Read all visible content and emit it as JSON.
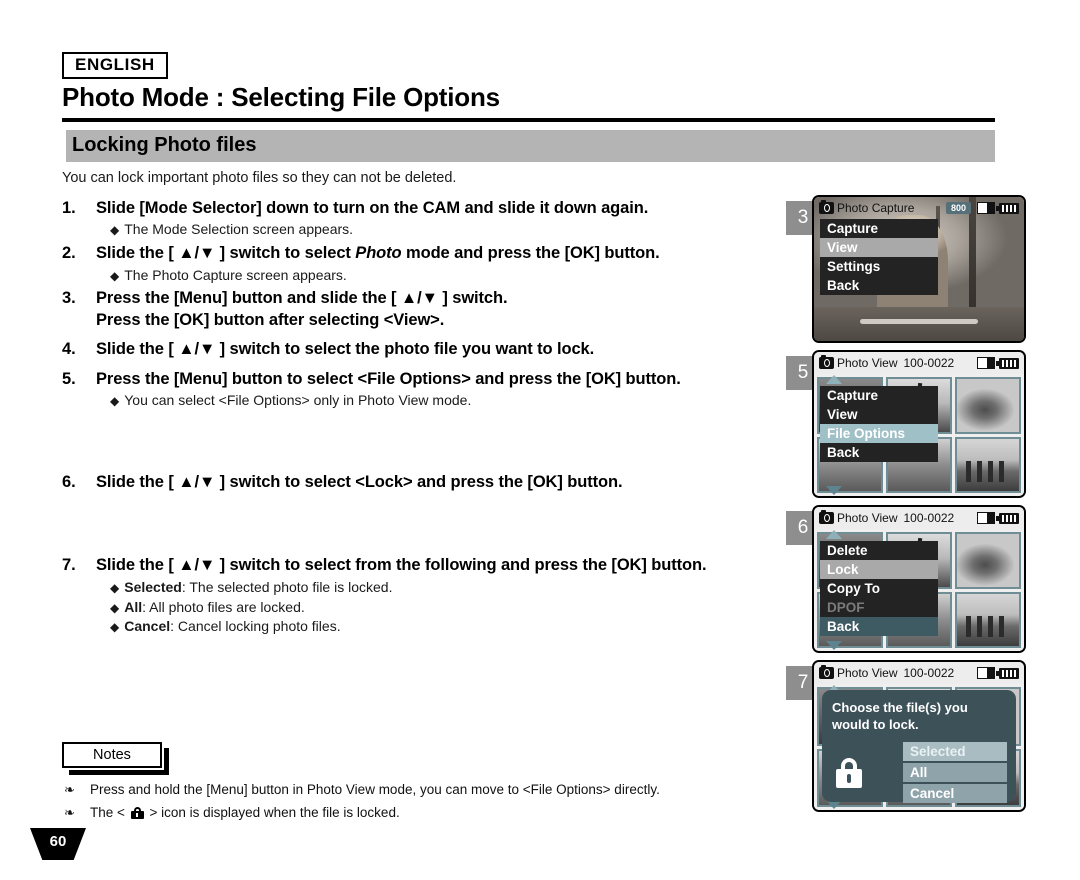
{
  "header": {
    "language": "ENGLISH",
    "title": "Photo Mode : Selecting File Options",
    "section": "Locking Photo files"
  },
  "intro": "You can lock important photo files so they can not be deleted.",
  "steps": [
    {
      "num": "1.",
      "lines": [
        "Slide [Mode Selector] down to turn on the CAM and slide it down again."
      ],
      "subs": [
        "The Mode Selection screen appears."
      ]
    },
    {
      "num": "2.",
      "lines": [
        "Slide the [ ▲/▼ ] switch to select Photo mode and press the [OK] button."
      ],
      "subs": [
        "The Photo Capture screen appears."
      ]
    },
    {
      "num": "3.",
      "lines": [
        "Press the [Menu] button and slide the [ ▲/▼ ] switch.",
        "Press the [OK] button after selecting <View>."
      ],
      "subs": []
    },
    {
      "num": "4.",
      "lines": [
        "Slide the [ ▲/▼ ] switch to select the photo file you want to lock."
      ],
      "subs": []
    },
    {
      "num": "5.",
      "lines": [
        "Press the [Menu] button to select <File Options> and press the [OK] button."
      ],
      "subs": [
        "You can select <File Options> only in Photo View mode."
      ]
    },
    {
      "num": "6.",
      "lines": [
        "Slide the [ ▲/▼ ] switch to select <Lock> and press the [OK] button."
      ],
      "subs": []
    },
    {
      "num": "7.",
      "lines": [
        "Slide the [ ▲/▼ ] switch to select from the following and press the [OK] button."
      ],
      "subs": [
        "Selected: The selected photo file is locked.",
        "All: All photo files are locked.",
        "Cancel: Cancel locking photo files."
      ]
    }
  ],
  "notes": {
    "tab_label": "Notes",
    "items": [
      "Press and hold the [Menu] button in Photo View mode, you can move to <File Options> directly.",
      "The <  > icon is displayed when the file is locked."
    ],
    "item2_pre": "The <",
    "item2_post": "> icon is displayed when the file is locked."
  },
  "page_number": "60",
  "screens": [
    {
      "badge": "3",
      "head_title": "Photo Capture",
      "head_file": "",
      "res_badge": "800",
      "menu": [
        {
          "label": "Capture",
          "state": "normal"
        },
        {
          "label": "View",
          "state": "selected"
        },
        {
          "label": "Settings",
          "state": "normal"
        },
        {
          "label": "Back",
          "state": "normal"
        }
      ]
    },
    {
      "badge": "5",
      "head_title": "Photo View",
      "head_file": "100-0022",
      "res_badge": "",
      "menu": [
        {
          "label": "Capture",
          "state": "normal"
        },
        {
          "label": "View",
          "state": "normal"
        },
        {
          "label": "File Options",
          "state": "selected-teal"
        },
        {
          "label": "Back",
          "state": "normal"
        }
      ]
    },
    {
      "badge": "6",
      "head_title": "Photo View",
      "head_file": "100-0022",
      "res_badge": "",
      "menu": [
        {
          "label": "Delete",
          "state": "normal"
        },
        {
          "label": "Lock",
          "state": "selected"
        },
        {
          "label": "Copy To",
          "state": "normal"
        },
        {
          "label": "DPOF",
          "state": "dim"
        },
        {
          "label": "Back",
          "state": "back-teal"
        }
      ]
    },
    {
      "badge": "7",
      "head_title": "Photo View",
      "head_file": "100-0022",
      "res_badge": "",
      "dialog": {
        "message": "Choose the file(s) you would to lock.",
        "buttons": [
          {
            "label": "Selected",
            "state": "highlighted"
          },
          {
            "label": "All",
            "state": "normal"
          },
          {
            "label": "Cancel",
            "state": "normal"
          }
        ]
      }
    }
  ],
  "colors": {
    "section_bar": "#b4b4b4",
    "badge_gray": "#8e8e8e",
    "menu_dark": "#232323",
    "menu_selected": "#a9a9a9",
    "teal_select": "#9fc0c6",
    "dialog_bg": "#3d5159"
  }
}
